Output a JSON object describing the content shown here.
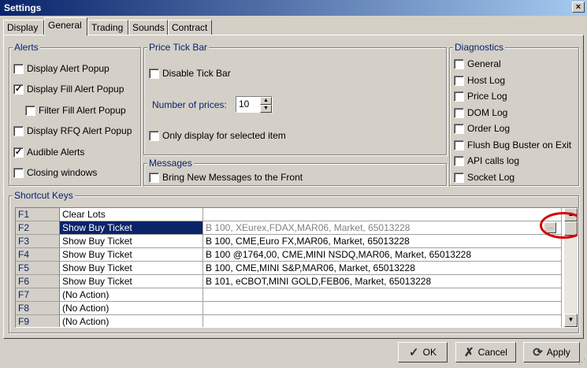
{
  "window": {
    "title": "Settings",
    "close_glyph": "×"
  },
  "tabs": [
    {
      "label": "Display"
    },
    {
      "label": "General",
      "active": true
    },
    {
      "label": "Trading"
    },
    {
      "label": "Sounds"
    },
    {
      "label": "Contract"
    }
  ],
  "alerts": {
    "label": "Alerts",
    "items": [
      {
        "label": "Display Alert Popup",
        "checked": false
      },
      {
        "label": "Display Fill Alert Popup",
        "checked": true
      },
      {
        "label": "Filter Fill Alert Popup",
        "checked": false
      },
      {
        "label": "Display RFQ Alert Popup",
        "checked": false
      },
      {
        "label": "Audible Alerts",
        "checked": true
      },
      {
        "label": "Closing windows",
        "checked": false
      }
    ]
  },
  "price_tick_bar": {
    "label": "Price Tick Bar",
    "disable": {
      "label": "Disable Tick Bar",
      "checked": false
    },
    "num_prices_label": "Number of prices:",
    "num_prices_value": "10",
    "only_selected": {
      "label": "Only display for selected item",
      "checked": false
    }
  },
  "messages": {
    "label": "Messages",
    "bring_front": {
      "label": "Bring New Messages to the Front",
      "checked": false
    }
  },
  "diagnostics": {
    "label": "Diagnostics",
    "items": [
      {
        "label": "General",
        "checked": false
      },
      {
        "label": "Host Log",
        "checked": false
      },
      {
        "label": "Price Log",
        "checked": false
      },
      {
        "label": "DOM Log",
        "checked": false
      },
      {
        "label": "Order Log",
        "checked": false
      },
      {
        "label": "Flush Bug Buster on Exit",
        "checked": false
      },
      {
        "label": "API calls log",
        "checked": false
      },
      {
        "label": "Socket Log",
        "checked": false
      }
    ]
  },
  "shortcut_keys": {
    "label": "Shortcut Keys",
    "rows": [
      {
        "key": "F1",
        "action": "Clear Lots",
        "detail": ""
      },
      {
        "key": "F2",
        "action": "Show Buy Ticket",
        "detail": "B 100, XEurex,FDAX,MAR06, Market, 65013228",
        "selected": true
      },
      {
        "key": "F3",
        "action": "Show Buy Ticket",
        "detail": "B 100, CME,Euro FX,MAR06, Market, 65013228"
      },
      {
        "key": "F4",
        "action": "Show Buy Ticket",
        "detail": "B 100 @1764,00, CME,MINI NSDQ,MAR06, Market, 65013228"
      },
      {
        "key": "F5",
        "action": "Show Buy Ticket",
        "detail": "B 100, CME,MINI S&P,MAR06, Market, 65013228"
      },
      {
        "key": "F6",
        "action": "Show Buy Ticket",
        "detail": "B 101, eCBOT,MINI GOLD,FEB06, Market, 65013228"
      },
      {
        "key": "F7",
        "action": "(No Action)",
        "detail": ""
      },
      {
        "key": "F8",
        "action": "(No Action)",
        "detail": ""
      },
      {
        "key": "F9",
        "action": "(No Action)",
        "detail": ""
      }
    ],
    "ellipsis_label": "...",
    "check_glyph": "✓",
    "up_glyph": "▲",
    "down_glyph": "▼"
  },
  "buttons": {
    "ok": {
      "label": "OK",
      "icon": "✓"
    },
    "cancel": {
      "label": "Cancel",
      "icon": "✗"
    },
    "apply": {
      "label": "Apply",
      "icon": "⟳"
    }
  },
  "colors": {
    "accent": "#0a246a",
    "highlight_circle": "#d40000"
  }
}
